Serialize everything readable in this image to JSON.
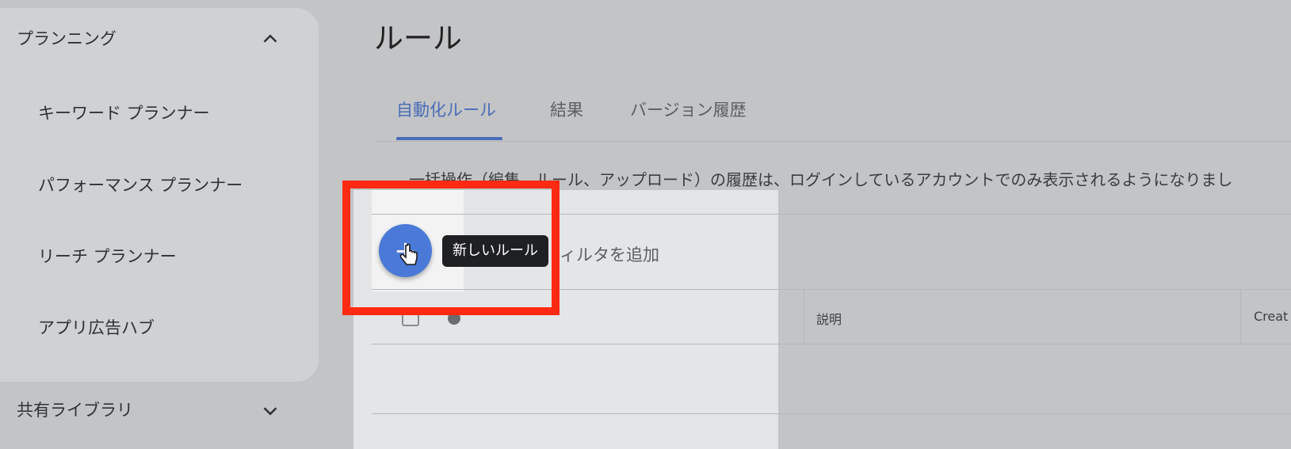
{
  "sidebar": {
    "planning": {
      "label": "プランニング",
      "items": [
        {
          "label": "キーワード プランナー"
        },
        {
          "label": "パフォーマンス プランナー"
        },
        {
          "label": "リーチ プランナー"
        },
        {
          "label": "アプリ広告ハブ"
        }
      ]
    },
    "shared_library": {
      "label": "共有ライブラリ"
    }
  },
  "page": {
    "title": "ルール",
    "tabs": [
      {
        "label": "自動化ルール",
        "active": true
      },
      {
        "label": "結果"
      },
      {
        "label": "バージョン履歴"
      }
    ],
    "notice": "一括操作（編集、ルール、アップロード）の履歴は、ログインしているアカウントでのみ表示されるようになりまし"
  },
  "toolbar": {
    "fab_icon": "plus-icon",
    "tooltip": "新しいルール",
    "filter_text": "ィルタを追加"
  },
  "table": {
    "columns": [
      "説明",
      "Creat"
    ]
  },
  "colors": {
    "accent": "#4a79d8",
    "highlight": "#ff2a12",
    "tab_active": "#4a6db8"
  }
}
